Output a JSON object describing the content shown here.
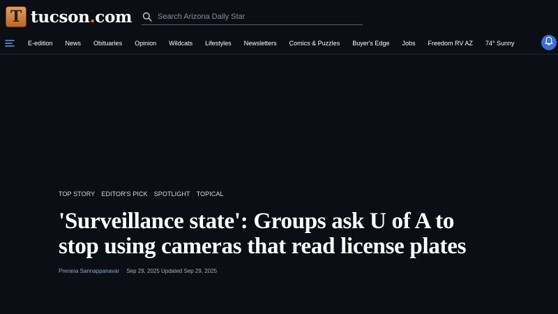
{
  "header": {
    "logo_letter": "T",
    "logo_name": "tucson",
    "logo_dot": ".",
    "logo_suffix": "com",
    "search_placeholder": "Search Arizona Daily Star"
  },
  "nav": {
    "items": [
      "E-edition",
      "News",
      "Obituaries",
      "Opinion",
      "Wildcats",
      "Lifestyles",
      "Newsletters",
      "Comics & Puzzles",
      "Buyer's Edge",
      "Jobs",
      "Freedom RV AZ",
      "74° Sunny"
    ]
  },
  "article": {
    "tags": [
      "TOP STORY",
      "EDITOR'S PICK",
      "SPOTLIGHT",
      "TOPICAL"
    ],
    "headline": "'Surveillance state': Groups ask U of A to stop using cameras that read license plates",
    "author": "Prerana Sannappanavar",
    "dates": "Sep 29, 2025 Updated Sep 29, 2025"
  },
  "icons": {
    "menu": "hamburger-menu-icon",
    "search": "search-icon",
    "notifications": "bell-icon"
  },
  "colors": {
    "background": "#0b0e14",
    "brand_orange": "#e07b2a",
    "bell_button": "#3b6fd4",
    "author_link": "#8fa9d6"
  }
}
